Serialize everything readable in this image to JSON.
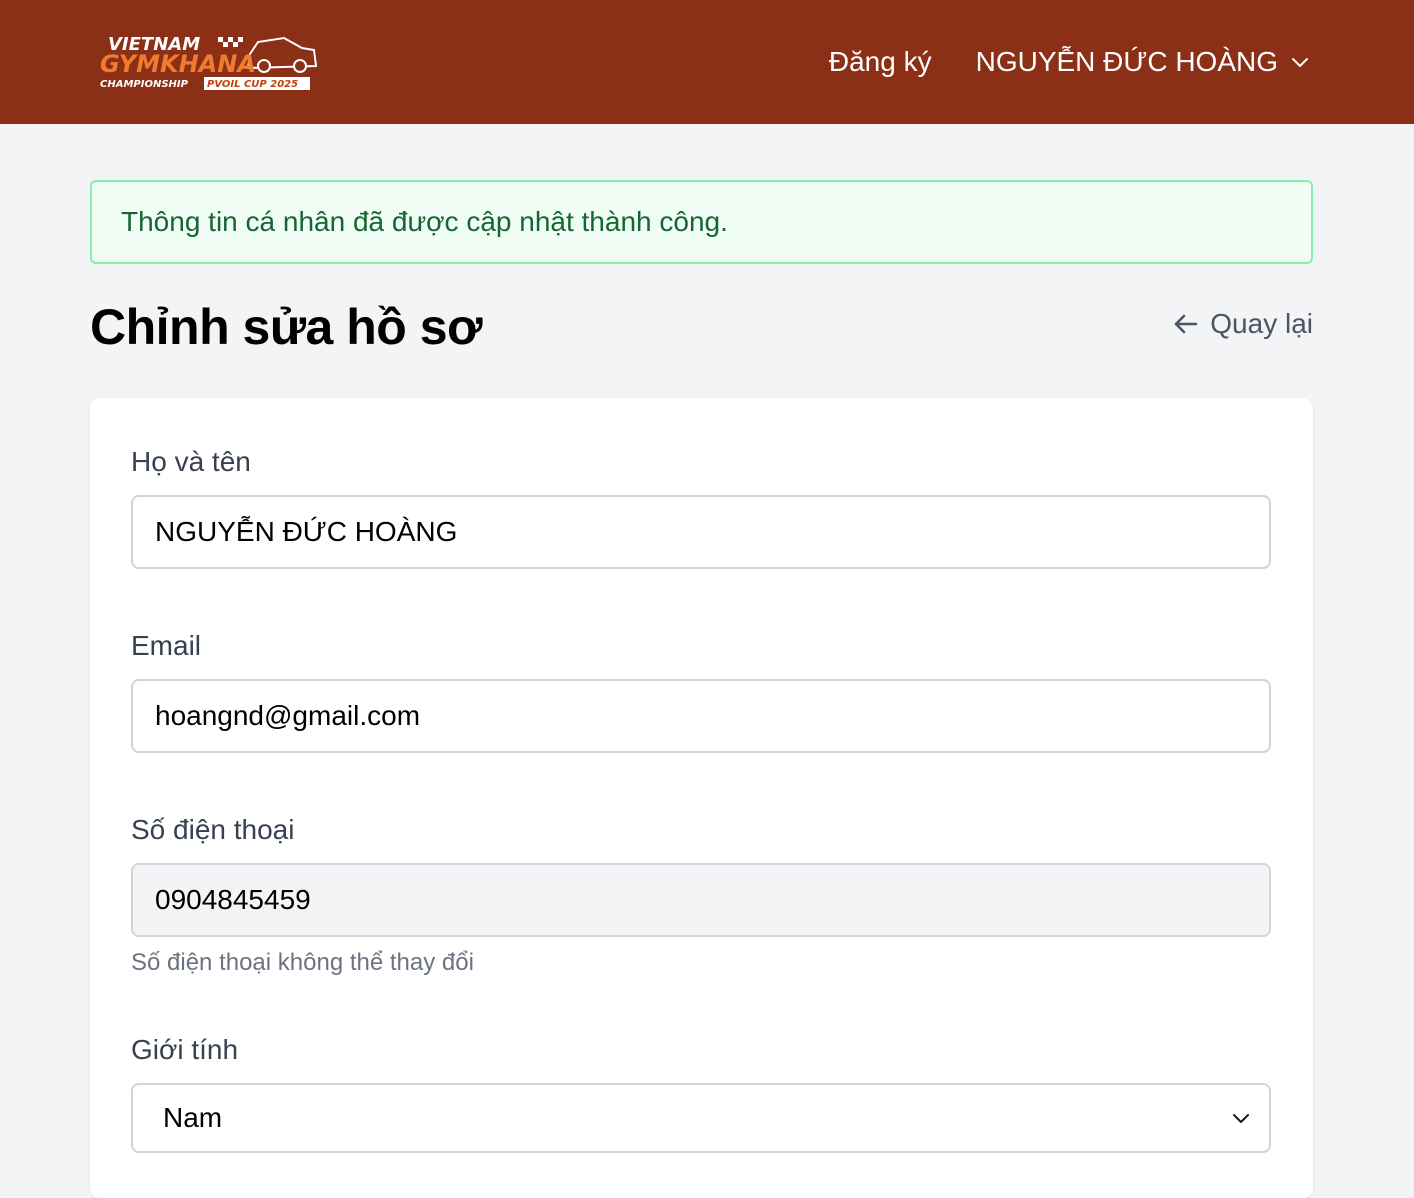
{
  "header": {
    "logo": {
      "line1": "VIETNAM",
      "line2": "GYMKHANA",
      "line3": "CHAMPIONSHIP",
      "line4": "PVOIL CUP 2025"
    },
    "nav_register": "Đăng ký",
    "user_name": "NGUYỄN ĐỨC HOÀNG"
  },
  "alert": {
    "message": "Thông tin cá nhân đã được cập nhật thành công."
  },
  "page": {
    "title": "Chỉnh sửa hồ sơ",
    "back_label": "Quay lại"
  },
  "form": {
    "full_name": {
      "label": "Họ và tên",
      "value": "NGUYỄN ĐỨC HOÀNG"
    },
    "email": {
      "label": "Email",
      "value": "hoangnd@gmail.com"
    },
    "phone": {
      "label": "Số điện thoại",
      "value": "0904845459",
      "hint": "Số điện thoại không thể thay đổi"
    },
    "gender": {
      "label": "Giới tính",
      "selected": "Nam"
    }
  },
  "colors": {
    "header_bg": "#8b2f17",
    "alert_bg": "#f0fdf4",
    "alert_border": "#86efac",
    "alert_text": "#166534"
  },
  "icons": {
    "back": "arrow-left-icon",
    "user_menu": "chevron-down-icon",
    "select": "chevron-down-icon"
  }
}
